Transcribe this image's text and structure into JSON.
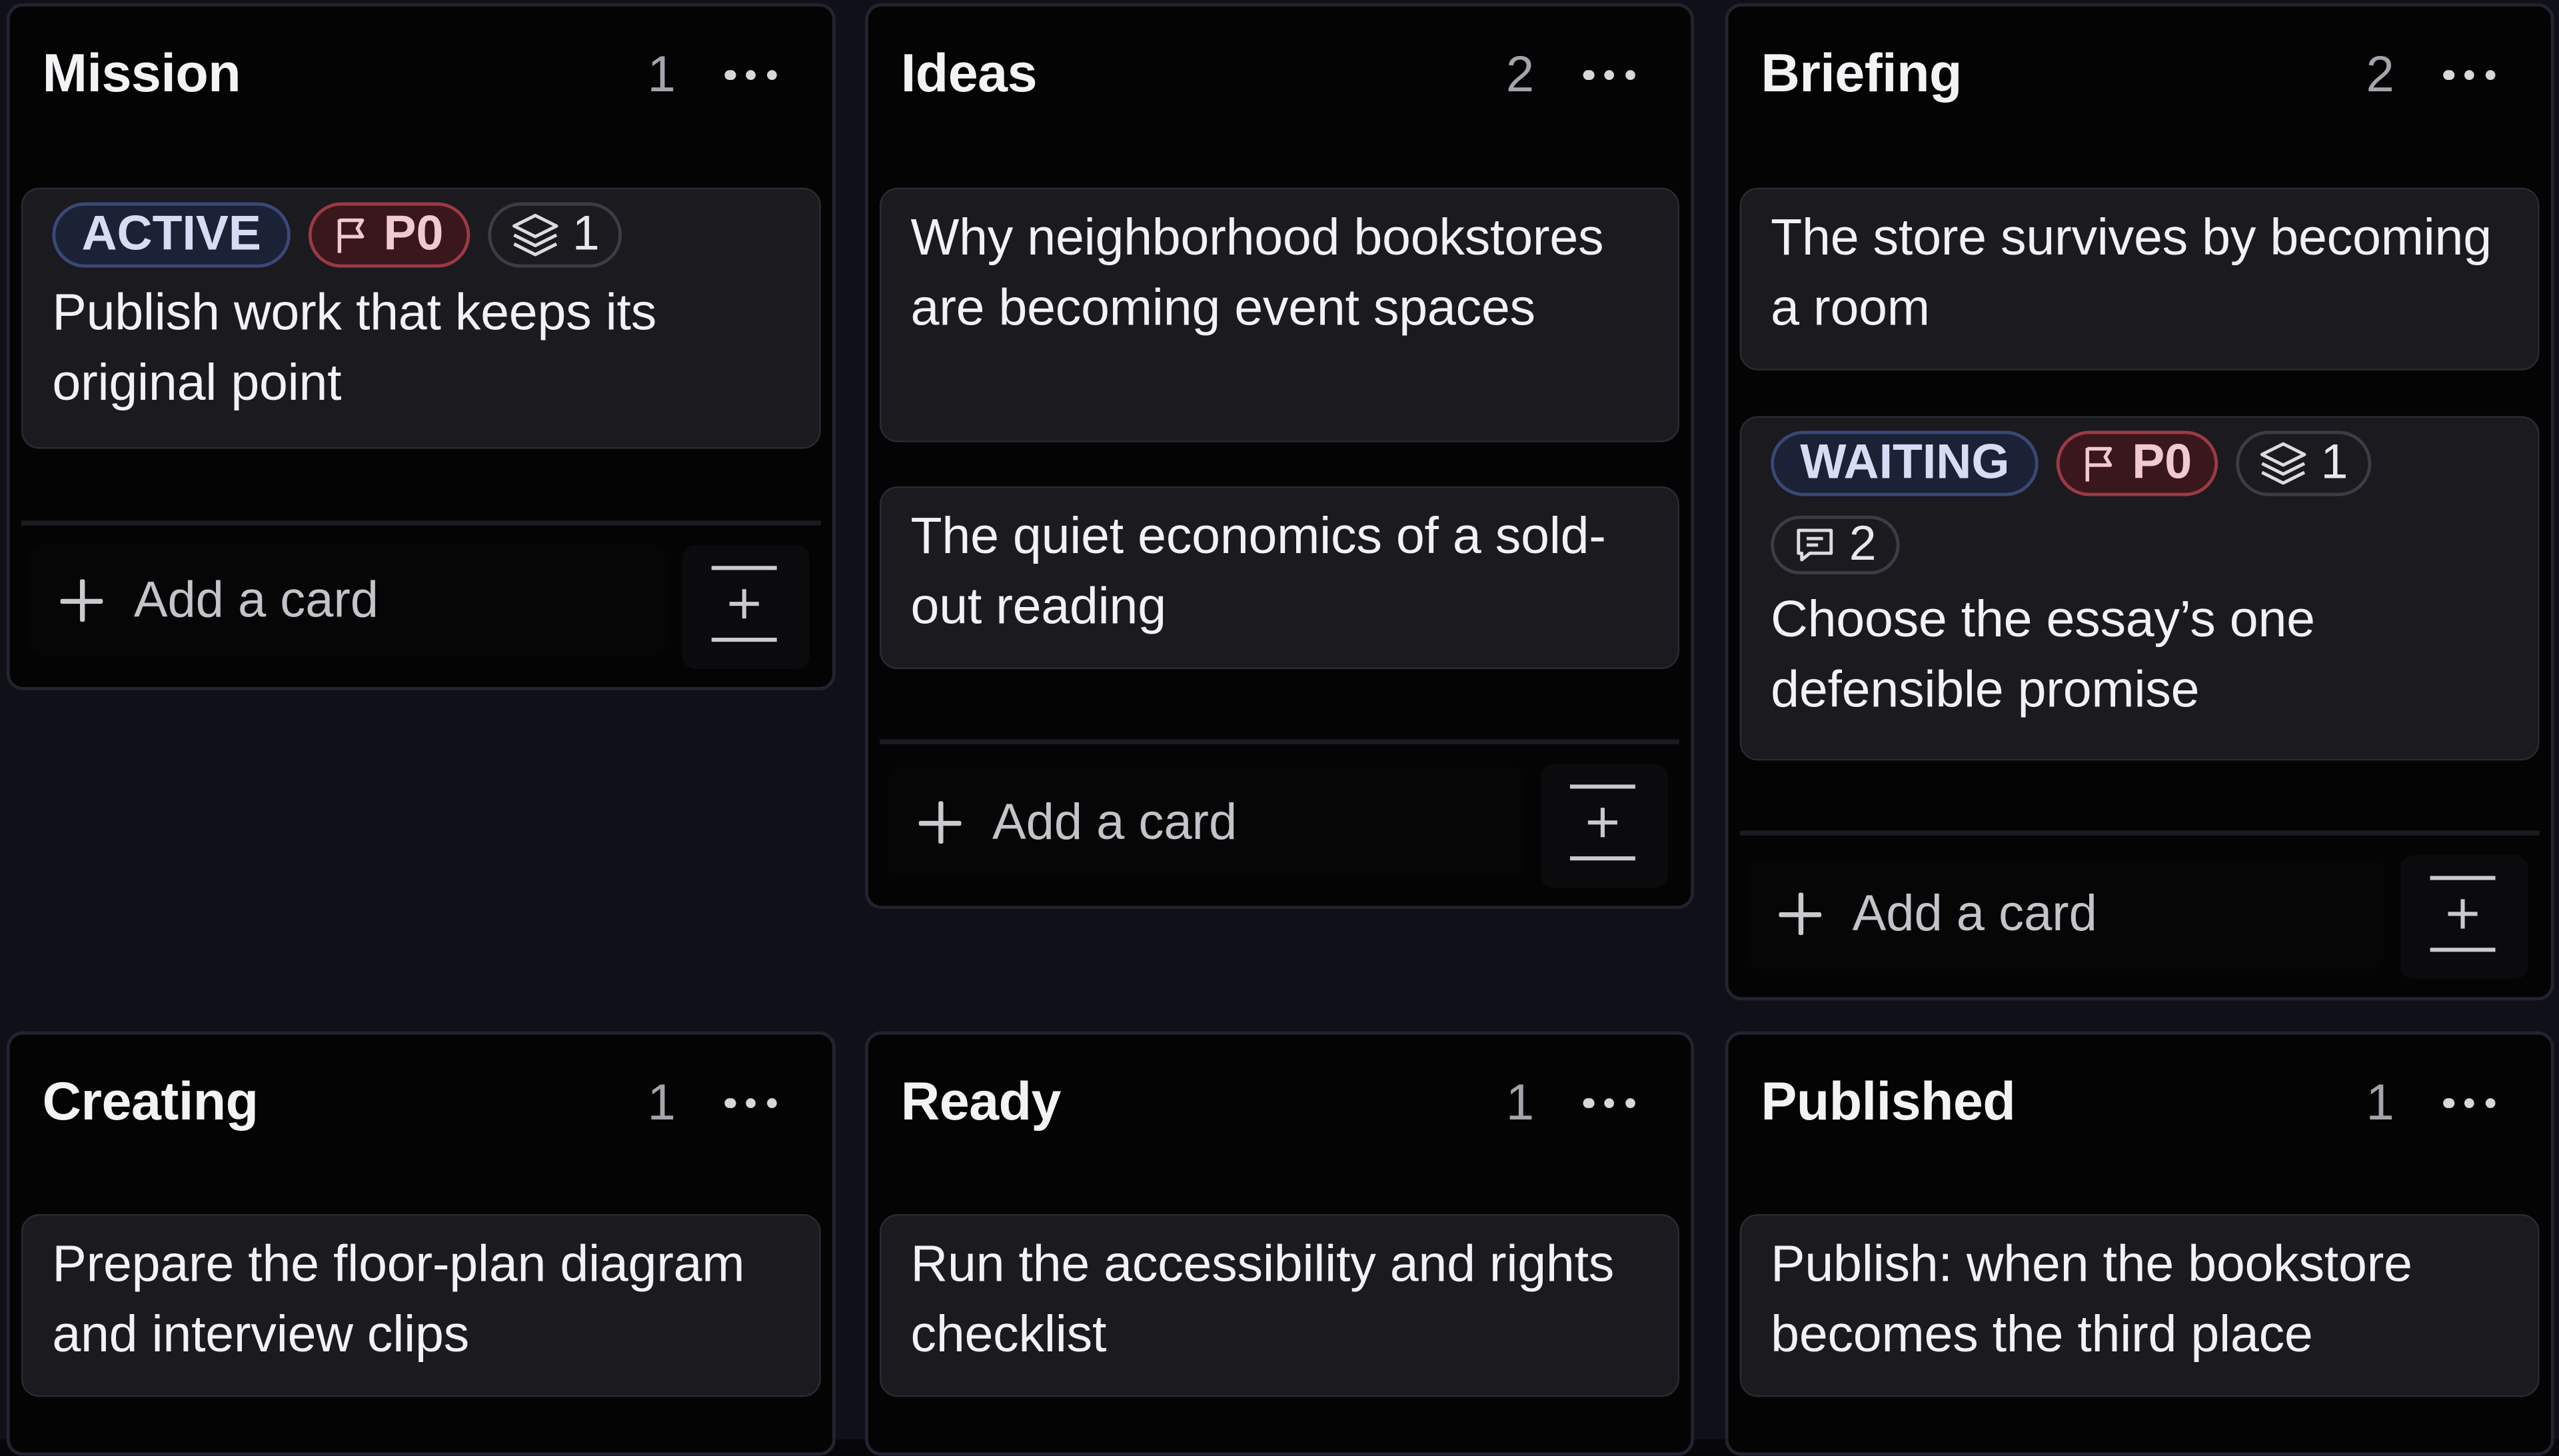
{
  "board": {
    "columns": [
      {
        "title": "Mission",
        "count": "1",
        "cards": [
          {
            "badges": [
              {
                "kind": "status",
                "text": "ACTIVE",
                "icon": ""
              },
              {
                "kind": "priority",
                "text": "P0",
                "icon": "flag-icon"
              },
              {
                "kind": "meta",
                "text": "1",
                "icon": "layers-icon"
              }
            ],
            "title": "Publish work that keeps its original point"
          }
        ],
        "add_label": "Add a card"
      },
      {
        "title": "Ideas",
        "count": "2",
        "cards": [
          {
            "badges": [],
            "title": "Why neighborhood bookstores are becoming event spaces"
          },
          {
            "badges": [],
            "title": "The quiet economics of a sold-out reading"
          }
        ],
        "add_label": "Add a card"
      },
      {
        "title": "Briefing",
        "count": "2",
        "cards": [
          {
            "badges": [],
            "title": "The store survives by becoming a room"
          },
          {
            "badges": [
              {
                "kind": "status",
                "text": "WAITING",
                "icon": ""
              },
              {
                "kind": "priority",
                "text": "P0",
                "icon": "flag-icon"
              },
              {
                "kind": "meta",
                "text": "1",
                "icon": "layers-icon"
              },
              {
                "kind": "meta",
                "text": "2",
                "icon": "comment-icon"
              }
            ],
            "title": "Choose the essay’s one defensible promise"
          }
        ],
        "add_label": "Add a card"
      },
      {
        "title": "Creating",
        "count": "1",
        "cards": [
          {
            "badges": [],
            "title": "Prepare the floor-plan diagram and interview clips"
          }
        ]
      },
      {
        "title": "Ready",
        "count": "1",
        "cards": [
          {
            "badges": [],
            "title": "Run the accessibility and rights checklist"
          }
        ]
      },
      {
        "title": "Published",
        "count": "1",
        "cards": [
          {
            "badges": [],
            "title": "Publish: when the bookstore becomes the third place"
          }
        ]
      }
    ]
  },
  "icons": {
    "column_menu": "more-horizontal-icon",
    "add": "plus-icon",
    "template": "add-from-template-icon"
  },
  "colors": {
    "background": "#040405",
    "card": "#1a1a1f",
    "status_badge_border": "#3a4878",
    "priority_badge_border": "#9a3a46"
  }
}
